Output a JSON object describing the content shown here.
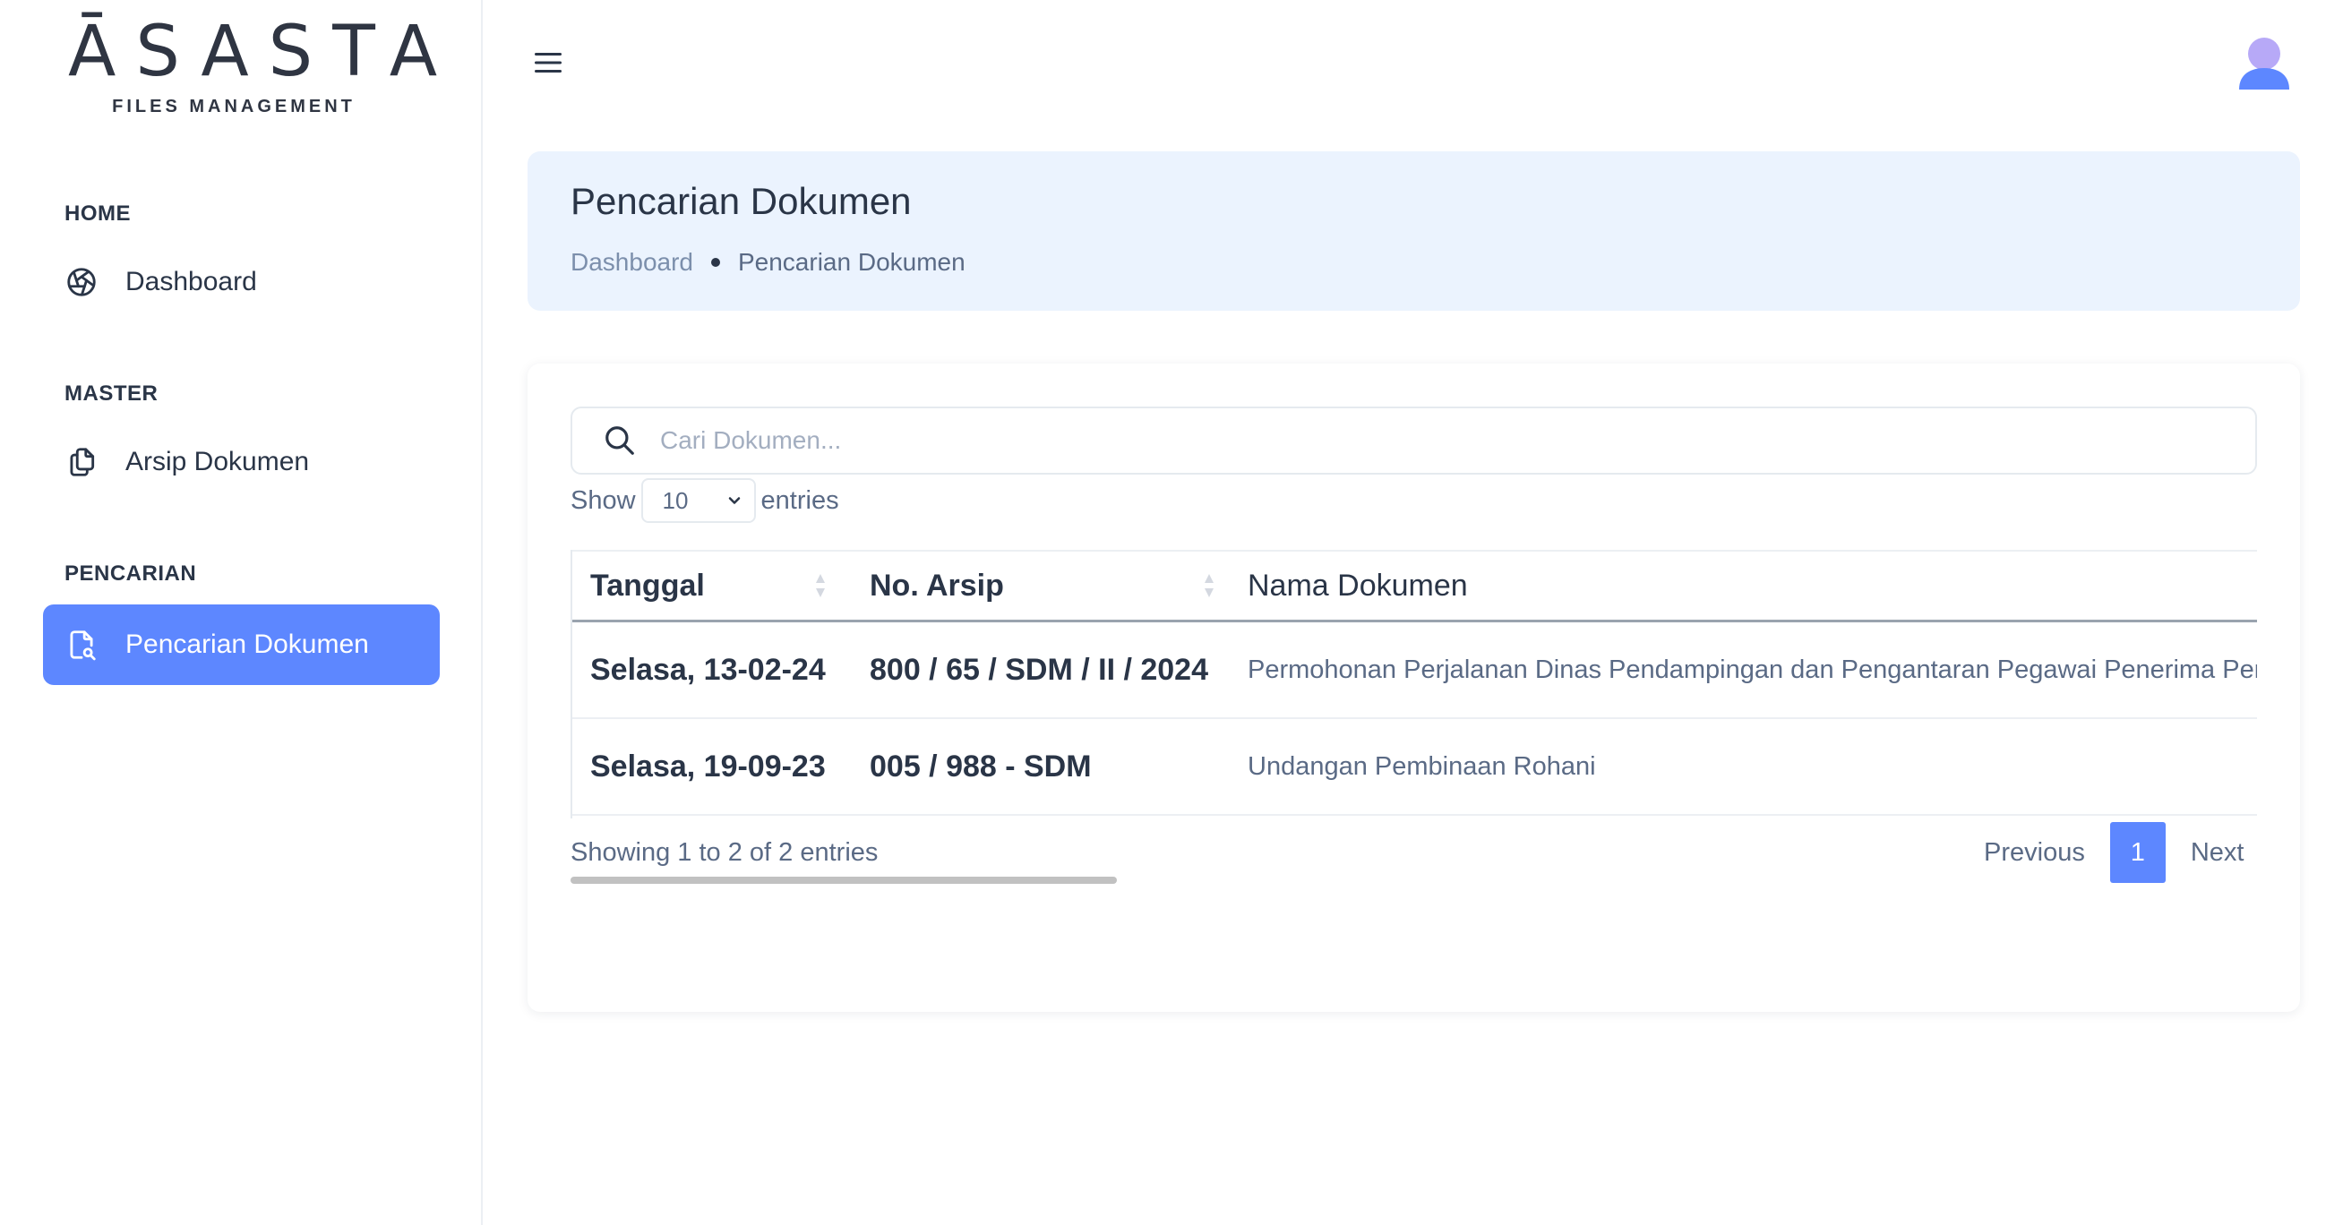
{
  "app": {
    "logo_title": "ĀSASTA",
    "logo_subtitle": "FILES MANAGEMENT"
  },
  "sidebar": {
    "sections": [
      {
        "title": "HOME",
        "items": [
          {
            "label": "Dashboard",
            "icon": "aperture-icon"
          }
        ]
      },
      {
        "title": "MASTER",
        "items": [
          {
            "label": "Arsip Dokumen",
            "icon": "copy-icon"
          }
        ]
      },
      {
        "title": "PENCARIAN",
        "items": [
          {
            "label": "Pencarian Dokumen",
            "icon": "file-search-icon",
            "active": true
          }
        ]
      }
    ]
  },
  "header": {
    "menu_icon": "hamburger-icon",
    "avatar_icon": "user-avatar-icon"
  },
  "page": {
    "title": "Pencarian Dokumen",
    "breadcrumb": [
      "Dashboard",
      "Pencarian Dokumen"
    ]
  },
  "search": {
    "placeholder": "Cari Dokumen...",
    "value": ""
  },
  "length_menu": {
    "prefix": "Show",
    "value": "10",
    "suffix": "entries"
  },
  "table": {
    "columns": [
      "Tanggal",
      "No. Arsip",
      "Nama Dokumen"
    ],
    "rows": [
      {
        "tanggal": "Selasa, 13-02-24",
        "no_arsip": "800 / 65 / SDM / II / 2024",
        "nama": "Permohonan Perjalanan Dinas Pendampingan dan Pengantaran Pegawai Penerima Pen"
      },
      {
        "tanggal": "Selasa, 19-09-23",
        "no_arsip": "005 / 988 - SDM",
        "nama": "Undangan Pembinaan Rohani"
      }
    ]
  },
  "footer": {
    "info": "Showing 1 to 2 of 2 entries",
    "previous": "Previous",
    "current_page": "1",
    "next": "Next"
  },
  "colors": {
    "primary": "#5d87ff",
    "title_bg": "#ebf3fe",
    "text": "#2a3547",
    "muted": "#5a6a85"
  }
}
